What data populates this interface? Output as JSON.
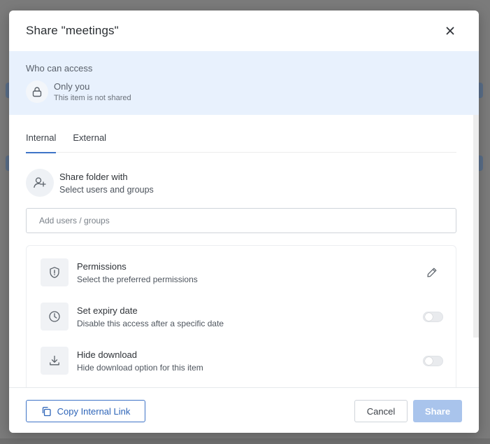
{
  "modal": {
    "title": "Share \"meetings\""
  },
  "access": {
    "heading": "Who can access",
    "title": "Only you",
    "subtitle": "This item is not shared",
    "icon": "lock-icon"
  },
  "tabs": [
    {
      "label": "Internal",
      "active": true
    },
    {
      "label": "External",
      "active": false
    }
  ],
  "share_with": {
    "title": "Share folder with",
    "subtitle": "Select users and groups",
    "icon": "add-user-icon"
  },
  "user_input": {
    "placeholder": "Add users / groups",
    "value": ""
  },
  "options": [
    {
      "title": "Permissions",
      "subtitle": "Select the preferred permissions",
      "icon": "shield-icon",
      "control": "edit"
    },
    {
      "title": "Set expiry date",
      "subtitle": "Disable this access after a specific date",
      "icon": "clock-icon",
      "control": "toggle",
      "enabled": false
    },
    {
      "title": "Hide download",
      "subtitle": "Hide download option for this item",
      "icon": "download-icon",
      "control": "toggle",
      "enabled": false
    }
  ],
  "footer": {
    "copy_link_label": "Copy Internal Link",
    "cancel_label": "Cancel",
    "share_label": "Share"
  },
  "colors": {
    "accent": "#3f74c7",
    "share_disabled": "#a9c4ec",
    "access_panel_bg": "#e8f1fd"
  }
}
